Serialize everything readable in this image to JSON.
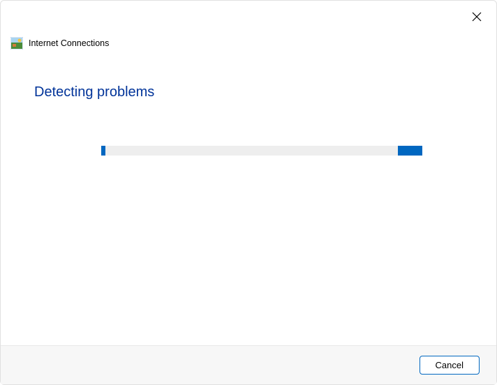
{
  "header": {
    "title": "Internet Connections",
    "icon": "network-troubleshoot-icon"
  },
  "main": {
    "heading": "Detecting problems"
  },
  "footer": {
    "cancel_label": "Cancel"
  },
  "colors": {
    "accent": "#0067c0",
    "heading": "#003399"
  }
}
